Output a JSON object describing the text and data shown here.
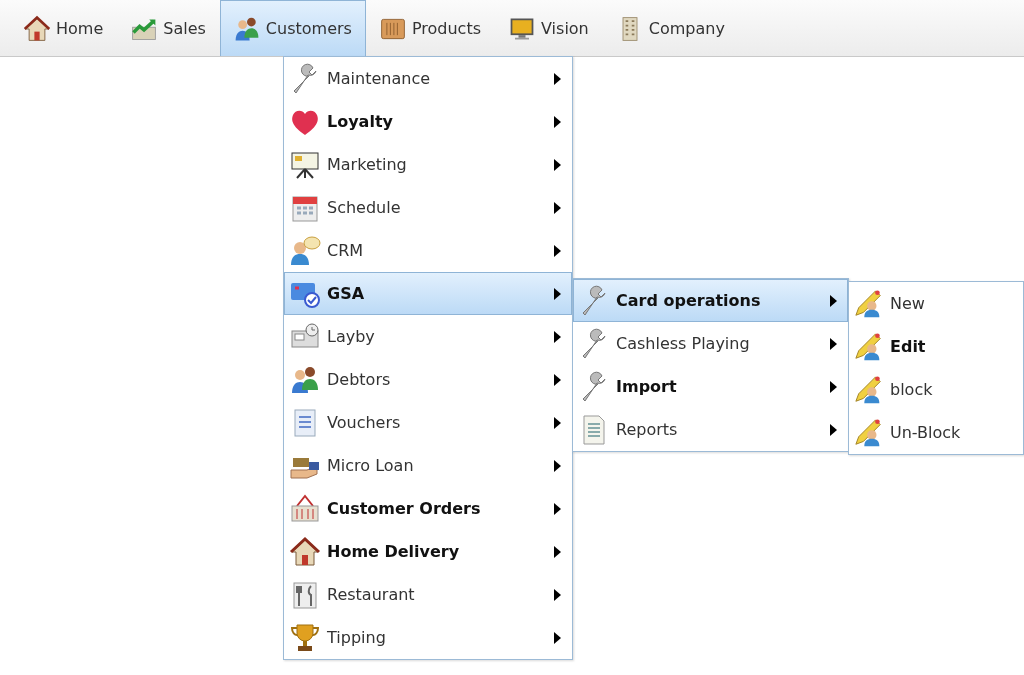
{
  "menu_bar": [
    {
      "label": "Home",
      "selected": false
    },
    {
      "label": "Sales",
      "selected": false
    },
    {
      "label": "Customers",
      "selected": true
    },
    {
      "label": "Products",
      "selected": false
    },
    {
      "label": "Vision",
      "selected": false
    },
    {
      "label": "Company",
      "selected": false
    }
  ],
  "customers_menu": [
    {
      "label": "Maintenance",
      "bold": false,
      "submenu": true,
      "selected": false
    },
    {
      "label": "Loyalty",
      "bold": true,
      "submenu": true,
      "selected": false
    },
    {
      "label": "Marketing",
      "bold": false,
      "submenu": true,
      "selected": false
    },
    {
      "label": "Schedule",
      "bold": false,
      "submenu": true,
      "selected": false
    },
    {
      "label": "CRM",
      "bold": false,
      "submenu": true,
      "selected": false
    },
    {
      "label": "GSA",
      "bold": true,
      "submenu": true,
      "selected": true
    },
    {
      "label": "Layby",
      "bold": false,
      "submenu": true,
      "selected": false
    },
    {
      "label": "Debtors",
      "bold": false,
      "submenu": true,
      "selected": false
    },
    {
      "label": "Vouchers",
      "bold": false,
      "submenu": true,
      "selected": false
    },
    {
      "label": "Micro Loan",
      "bold": false,
      "submenu": true,
      "selected": false
    },
    {
      "label": "Customer Orders",
      "bold": true,
      "submenu": true,
      "selected": false
    },
    {
      "label": "Home Delivery",
      "bold": true,
      "submenu": true,
      "selected": false
    },
    {
      "label": "Restaurant",
      "bold": false,
      "submenu": true,
      "selected": false
    },
    {
      "label": "Tipping",
      "bold": false,
      "submenu": true,
      "selected": false
    }
  ],
  "gsa_menu": [
    {
      "label": "Card operations",
      "bold": true,
      "submenu": true,
      "selected": true
    },
    {
      "label": "Cashless Playing",
      "bold": false,
      "submenu": true,
      "selected": false
    },
    {
      "label": "Import",
      "bold": true,
      "submenu": true,
      "selected": false
    },
    {
      "label": "Reports",
      "bold": false,
      "submenu": true,
      "selected": false
    }
  ],
  "card_operations_menu": [
    {
      "label": "New",
      "bold": false,
      "submenu": false,
      "selected": false
    },
    {
      "label": "Edit",
      "bold": true,
      "submenu": false,
      "selected": false
    },
    {
      "label": "block",
      "bold": false,
      "submenu": false,
      "selected": false
    },
    {
      "label": "Un-Block",
      "bold": false,
      "submenu": false,
      "selected": false
    }
  ]
}
